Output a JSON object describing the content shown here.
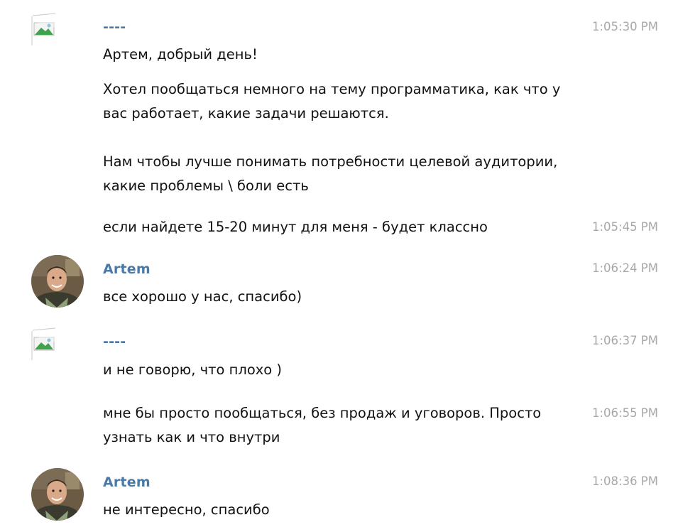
{
  "colors": {
    "sender_name": "#4a7aa5",
    "timestamp": "#a8a8a8",
    "message_text": "#111111",
    "background": "#ffffff"
  },
  "messages": [
    {
      "sender": "----",
      "avatar": "broken-image-icon",
      "time": "1:05:30 PM",
      "lines": [
        "Артем, добрый день!",
        "Хотел пообщаться немного на тему программатика, как что у\nвас работает, какие задачи решаются.\n\nНам чтобы лучше понимать потребности целевой аудитории,\nкакие проблемы \\ боли есть"
      ]
    },
    {
      "time": "1:05:45 PM",
      "text": "если найдете 15-20 минут для меня - будет классно"
    },
    {
      "sender": "Artem",
      "avatar": "user-photo",
      "time": "1:06:24 PM",
      "text": "все хорошо у нас, спасибо)"
    },
    {
      "sender": "----",
      "avatar": "broken-image-icon",
      "time": "1:06:37 PM",
      "text": "и не говорю, что плохо )"
    },
    {
      "time": "1:06:55 PM",
      "text": "мне бы просто пообщаться, без продаж и уговоров. Просто\nузнать как и что внутри"
    },
    {
      "sender": "Artem",
      "avatar": "user-photo",
      "time": "1:08:36 PM",
      "text": "не интересно, спасибо"
    }
  ]
}
